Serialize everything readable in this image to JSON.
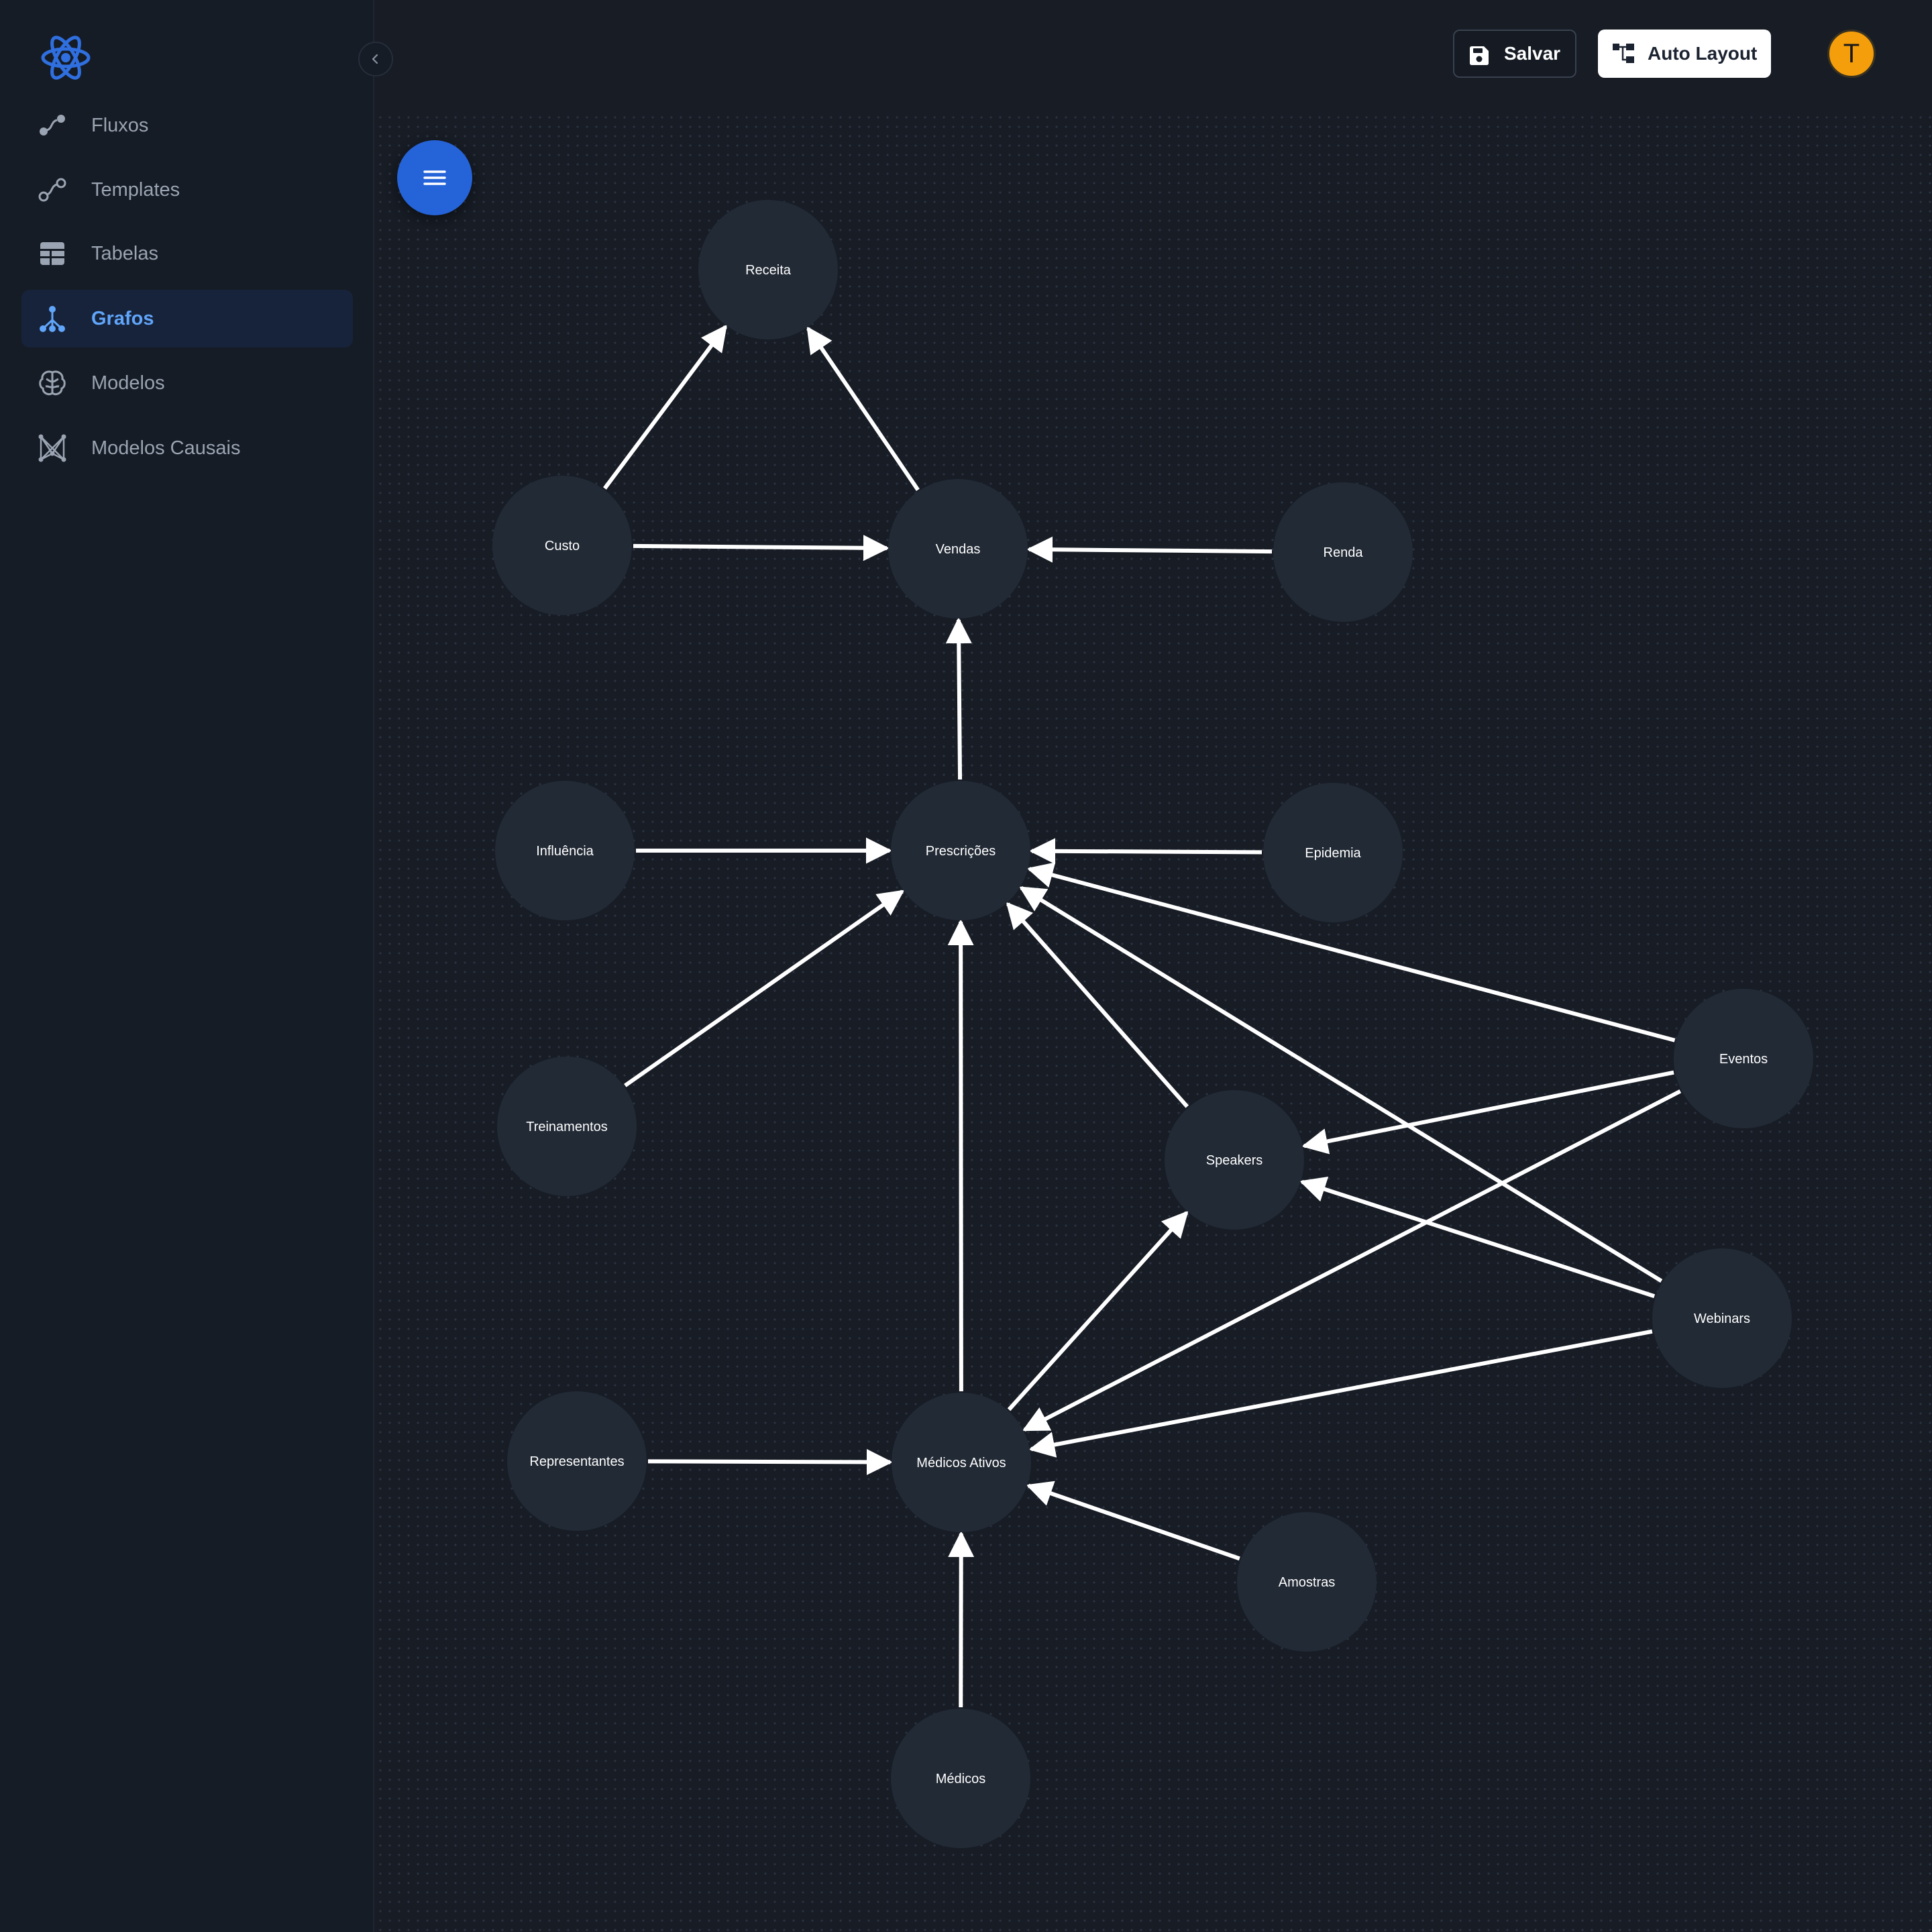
{
  "sidebar": {
    "items": [
      {
        "label": "Fluxos",
        "icon": "flow-icon",
        "active": false
      },
      {
        "label": "Templates",
        "icon": "template-icon",
        "active": false
      },
      {
        "label": "Tabelas",
        "icon": "table-icon",
        "active": false
      },
      {
        "label": "Grafos",
        "icon": "graph-icon",
        "active": true
      },
      {
        "label": "Modelos",
        "icon": "brain-icon",
        "active": false
      },
      {
        "label": "Modelos Causais",
        "icon": "causal-network-icon",
        "active": false
      }
    ]
  },
  "header": {
    "save_label": "Salvar",
    "auto_layout_label": "Auto Layout",
    "avatar_initial": "T"
  },
  "colors": {
    "accent": "#2563d8",
    "active_nav_text": "#60a5fa",
    "node_fill": "#222a35",
    "edge": "#ffffff",
    "avatar": "#f59e0b"
  },
  "graph": {
    "nodes": [
      {
        "id": "receita",
        "label": "Receita"
      },
      {
        "id": "custo",
        "label": "Custo"
      },
      {
        "id": "vendas",
        "label": "Vendas"
      },
      {
        "id": "renda",
        "label": "Renda"
      },
      {
        "id": "influencia",
        "label": "Influência"
      },
      {
        "id": "prescricoes",
        "label": "Prescrições"
      },
      {
        "id": "epidemia",
        "label": "Epidemia"
      },
      {
        "id": "treinamentos",
        "label": "Treinamentos"
      },
      {
        "id": "speakers",
        "label": "Speakers"
      },
      {
        "id": "eventos",
        "label": "Eventos"
      },
      {
        "id": "webinars",
        "label": "Webinars"
      },
      {
        "id": "representantes",
        "label": "Representantes"
      },
      {
        "id": "medicos_ativos",
        "label": "Médicos Ativos"
      },
      {
        "id": "amostras",
        "label": "Amostras"
      },
      {
        "id": "medicos",
        "label": "Médicos"
      }
    ],
    "edges": [
      {
        "from": "custo",
        "to": "receita"
      },
      {
        "from": "vendas",
        "to": "receita"
      },
      {
        "from": "custo",
        "to": "vendas"
      },
      {
        "from": "renda",
        "to": "vendas"
      },
      {
        "from": "prescricoes",
        "to": "vendas"
      },
      {
        "from": "influencia",
        "to": "prescricoes"
      },
      {
        "from": "epidemia",
        "to": "prescricoes"
      },
      {
        "from": "treinamentos",
        "to": "prescricoes"
      },
      {
        "from": "medicos_ativos",
        "to": "prescricoes"
      },
      {
        "from": "speakers",
        "to": "prescricoes"
      },
      {
        "from": "eventos",
        "to": "prescricoes"
      },
      {
        "from": "webinars",
        "to": "prescricoes"
      },
      {
        "from": "eventos",
        "to": "speakers"
      },
      {
        "from": "webinars",
        "to": "speakers"
      },
      {
        "from": "medicos_ativos",
        "to": "speakers"
      },
      {
        "from": "eventos",
        "to": "medicos_ativos"
      },
      {
        "from": "webinars",
        "to": "medicos_ativos"
      },
      {
        "from": "representantes",
        "to": "medicos_ativos"
      },
      {
        "from": "amostras",
        "to": "medicos_ativos"
      },
      {
        "from": "medicos",
        "to": "medicos_ativos"
      }
    ]
  }
}
